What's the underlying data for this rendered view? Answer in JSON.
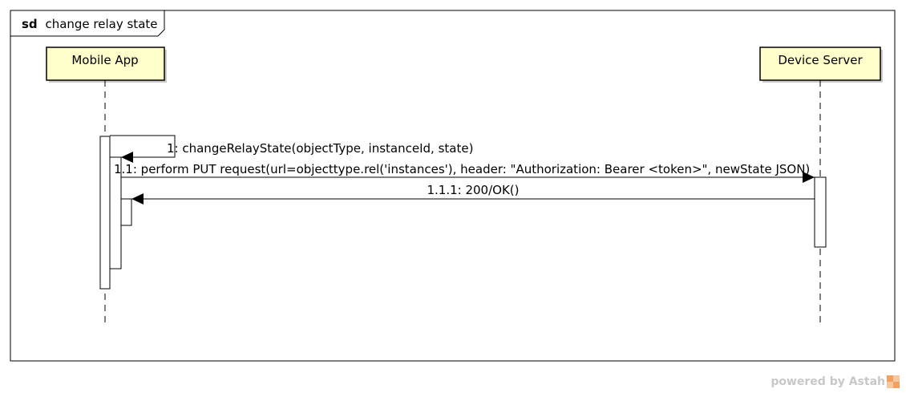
{
  "frame": {
    "keyword": "sd",
    "name": "change relay state"
  },
  "lifelines": [
    {
      "id": "app",
      "label": "Mobile App"
    },
    {
      "id": "server",
      "label": "Device Server"
    }
  ],
  "messages": [
    {
      "id": "m1",
      "label": "1: changeRelayState(objectType, instanceId, state)",
      "kind": "self"
    },
    {
      "id": "m2",
      "label": "1.1: perform PUT request(url=objecttype.rel('instances'), header: \"Authorization: Bearer <token>\", newState JSON)",
      "kind": "call"
    },
    {
      "id": "m3",
      "label": "1.1.1: 200/OK()",
      "kind": "call"
    }
  ],
  "footer": {
    "text": "powered by Astah"
  },
  "colors": {
    "lifeline_head_fill": "#ffffcc",
    "stroke": "#000000",
    "footer_text": "#c8c8c8",
    "logo_orange": "#f0a060"
  }
}
